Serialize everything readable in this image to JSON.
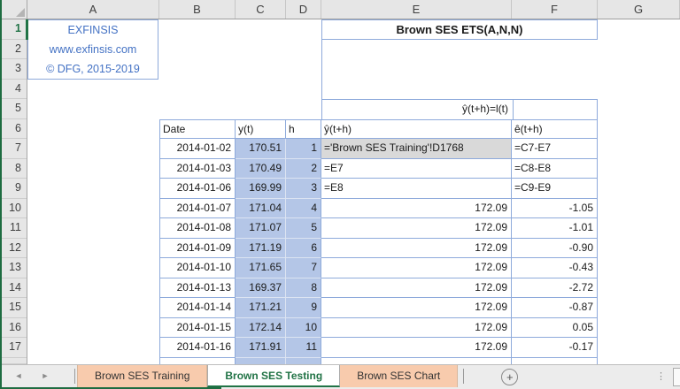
{
  "sheet": {
    "column_headers": [
      "A",
      "B",
      "C",
      "D",
      "E",
      "F",
      "G"
    ],
    "row_headers": [
      "1",
      "2",
      "3",
      "4",
      "5",
      "6",
      "7",
      "8",
      "9",
      "10",
      "11",
      "12",
      "13",
      "14",
      "15",
      "16",
      "17"
    ],
    "logo": {
      "line1": "EXFINSIS",
      "line2": "www.exfinsis.com",
      "line3": "© DFG, 2015-2019"
    },
    "title": "Brown SES ETS(A,N,N)",
    "equation": "ŷ(t+h)=l(t)",
    "table": {
      "headers": {
        "date": "Date",
        "y": "y(t)",
        "h": "h",
        "yhat": "ŷ(t+h)",
        "ehat": "ê(t+h)"
      },
      "rows": [
        {
          "row": "7",
          "date": "2014-01-02",
          "y": "170.51",
          "h": "1",
          "yhat": "='Brown SES Training'!D1768",
          "ehat": "=C7-E7",
          "yhat_highlight": true
        },
        {
          "row": "8",
          "date": "2014-01-03",
          "y": "170.49",
          "h": "2",
          "yhat": "=E7",
          "ehat": "=C8-E8"
        },
        {
          "row": "9",
          "date": "2014-01-06",
          "y": "169.99",
          "h": "3",
          "yhat": "=E8",
          "ehat": "=C9-E9"
        },
        {
          "row": "10",
          "date": "2014-01-07",
          "y": "171.04",
          "h": "4",
          "yhat": "172.09",
          "ehat": "-1.05"
        },
        {
          "row": "11",
          "date": "2014-01-08",
          "y": "171.07",
          "h": "5",
          "yhat": "172.09",
          "ehat": "-1.01"
        },
        {
          "row": "12",
          "date": "2014-01-09",
          "y": "171.19",
          "h": "6",
          "yhat": "172.09",
          "ehat": "-0.90"
        },
        {
          "row": "13",
          "date": "2014-01-10",
          "y": "171.65",
          "h": "7",
          "yhat": "172.09",
          "ehat": "-0.43"
        },
        {
          "row": "14",
          "date": "2014-01-13",
          "y": "169.37",
          "h": "8",
          "yhat": "172.09",
          "ehat": "-2.72"
        },
        {
          "row": "15",
          "date": "2014-01-14",
          "y": "171.21",
          "h": "9",
          "yhat": "172.09",
          "ehat": "-0.87"
        },
        {
          "row": "16",
          "date": "2014-01-15",
          "y": "172.14",
          "h": "10",
          "yhat": "172.09",
          "ehat": "0.05"
        },
        {
          "row": "17",
          "date": "2014-01-16",
          "y": "171.91",
          "h": "11",
          "yhat": "172.09",
          "ehat": "-0.17"
        }
      ]
    }
  },
  "tabbar": {
    "prev_icon": "◄",
    "next_icon": "►",
    "tabs": [
      {
        "label": "Brown SES Training",
        "active": false
      },
      {
        "label": "Brown SES Testing",
        "active": true
      },
      {
        "label": "Brown SES Chart",
        "active": false
      }
    ],
    "new_sheet_icon": "+",
    "options_icon": "⋮"
  },
  "colors": {
    "table_border_blue": "#8EAADB",
    "cell_fill_blue": "#B4C6E7",
    "cell_fill_gray": "#D9D9D9",
    "logo_text_blue": "#4472C4",
    "excel_green": "#217346",
    "tab_fill_peach": "#F8CBAD",
    "header_gray": "#E6E6E6"
  }
}
